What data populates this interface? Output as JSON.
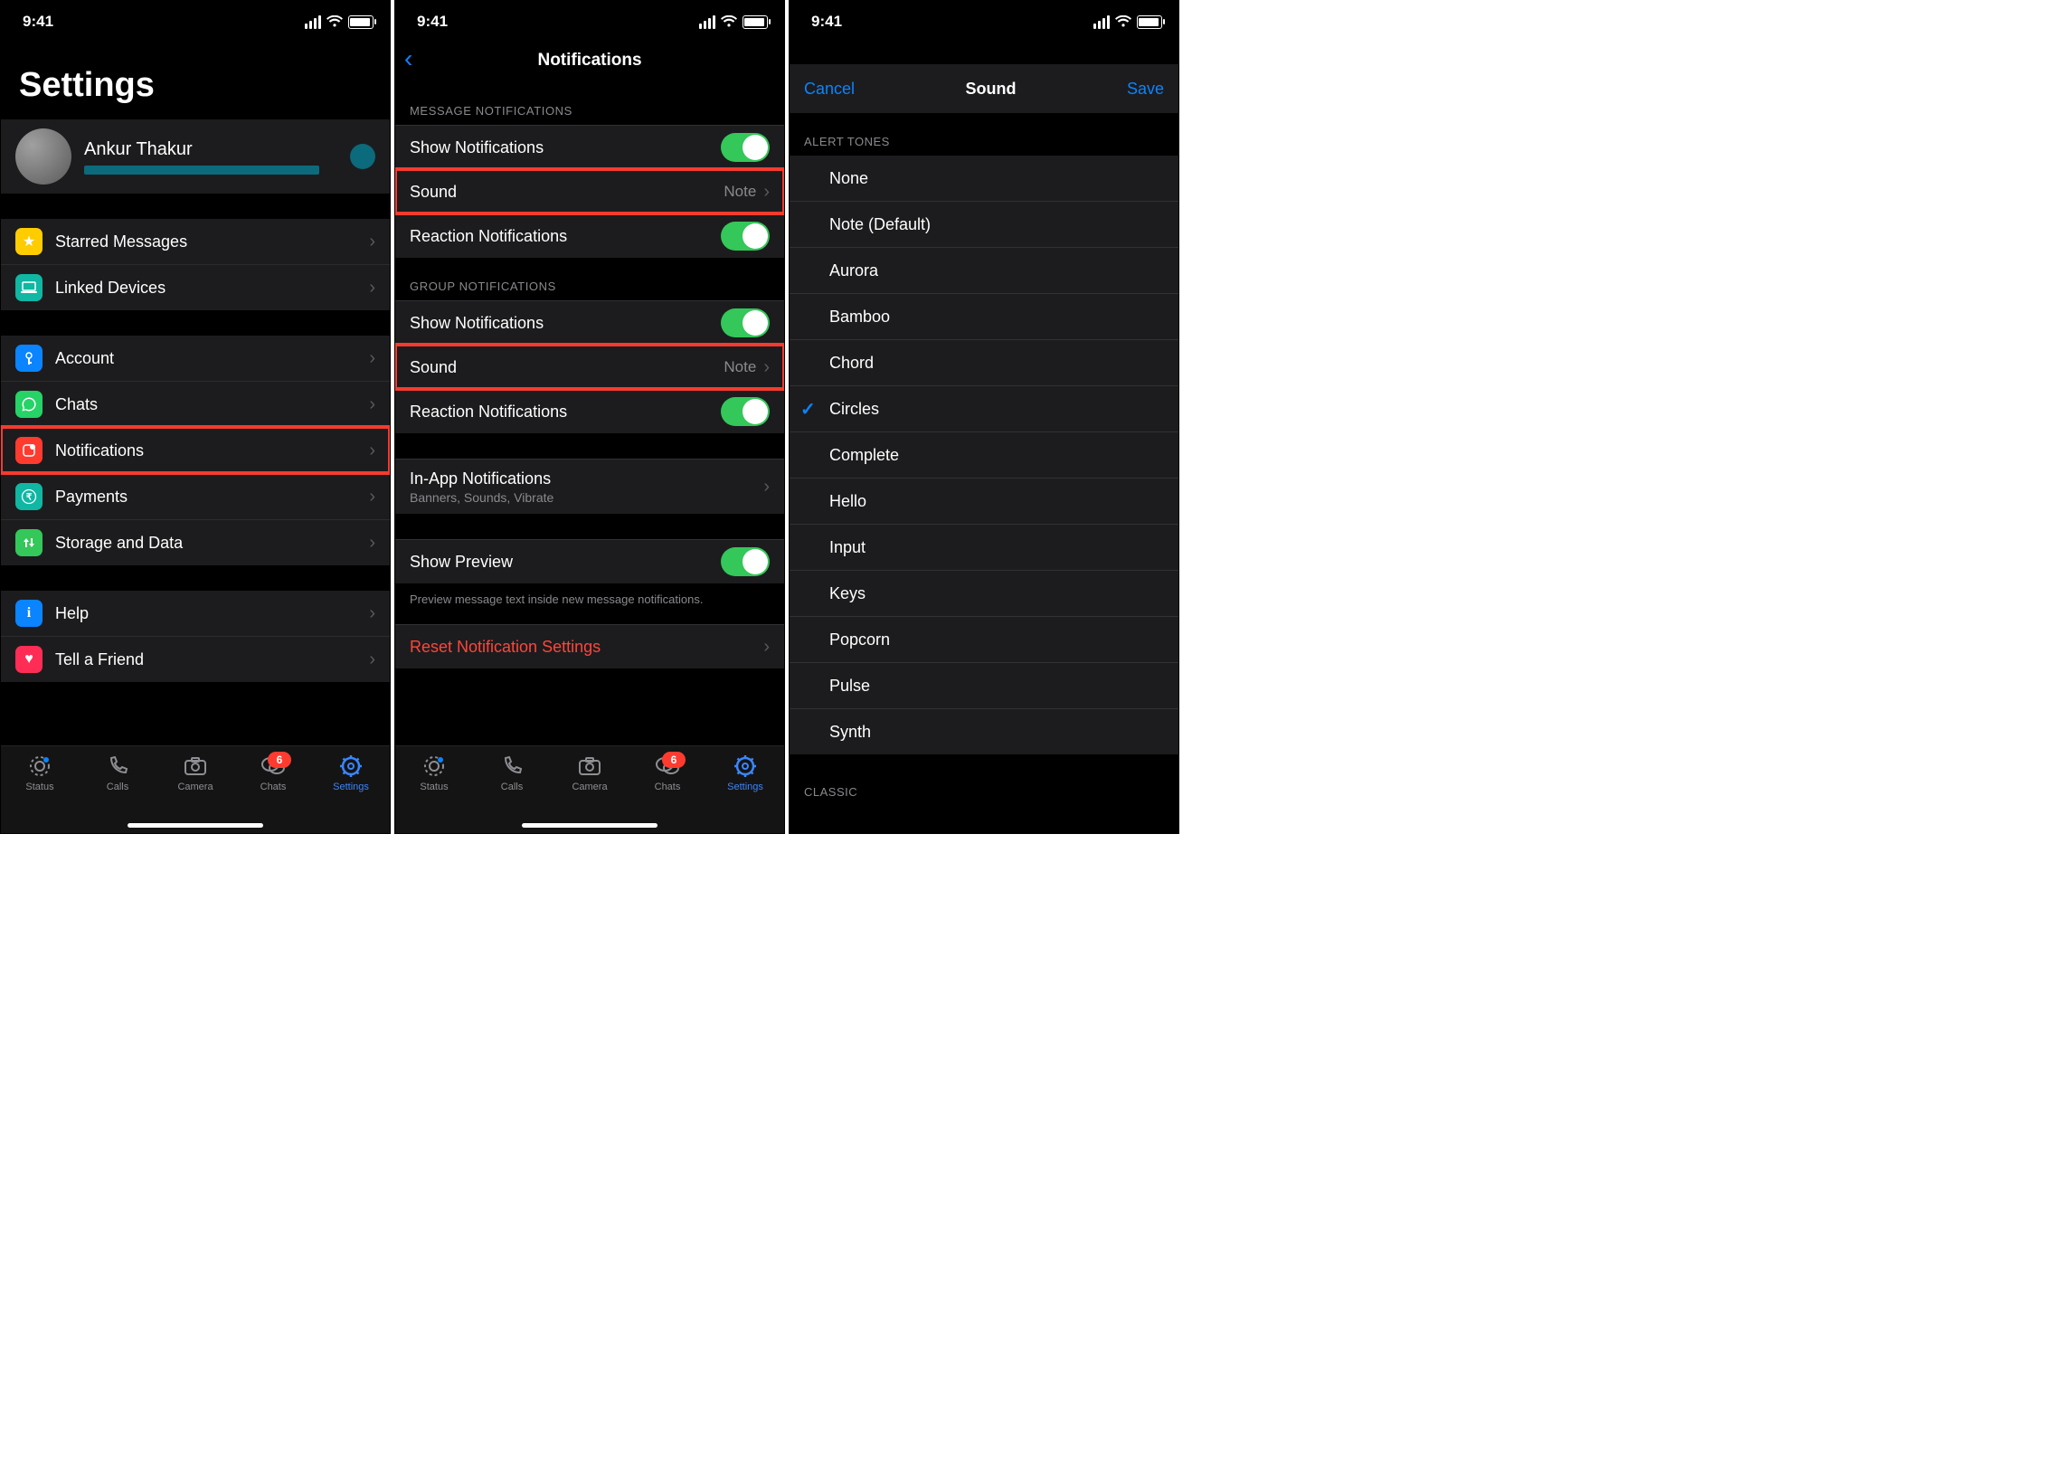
{
  "status": {
    "time": "9:41"
  },
  "panel1": {
    "title": "Settings",
    "profile": {
      "name": "Ankur Thakur"
    },
    "group1": [
      {
        "icon": "star-icon",
        "bg": "#ffcc00",
        "label": "Starred Messages"
      },
      {
        "icon": "laptop-icon",
        "bg": "#10b7a3",
        "label": "Linked Devices"
      }
    ],
    "group2": [
      {
        "icon": "key-icon",
        "bg": "#0a84ff",
        "label": "Account"
      },
      {
        "icon": "whatsapp-icon",
        "bg": "#25d366",
        "label": "Chats"
      },
      {
        "icon": "notification-icon",
        "bg": "#ff3b30",
        "label": "Notifications",
        "highlight": true
      },
      {
        "icon": "rupee-icon",
        "bg": "#10b7a3",
        "label": "Payments"
      },
      {
        "icon": "updown-icon",
        "bg": "#34c759",
        "label": "Storage and Data"
      }
    ],
    "group3": [
      {
        "icon": "info-icon",
        "bg": "#0a84ff",
        "label": "Help"
      },
      {
        "icon": "heart-icon",
        "bg": "#ff2d55",
        "label": "Tell a Friend"
      }
    ]
  },
  "panel2": {
    "title": "Notifications",
    "sections": {
      "msg_header": "MESSAGE NOTIFICATIONS",
      "grp_header": "GROUP NOTIFICATIONS"
    },
    "rows": {
      "show_notifs": "Show Notifications",
      "sound": "Sound",
      "sound_value": "Note",
      "reaction": "Reaction Notifications",
      "inapp": "In-App Notifications",
      "inapp_sub": "Banners, Sounds, Vibrate",
      "preview": "Show Preview",
      "preview_note": "Preview message text inside new message notifications.",
      "reset": "Reset Notification Settings"
    }
  },
  "panel3": {
    "cancel": "Cancel",
    "title": "Sound",
    "save": "Save",
    "header1": "ALERT TONES",
    "header2": "CLASSIC",
    "tones": [
      "None",
      "Note (Default)",
      "Aurora",
      "Bamboo",
      "Chord",
      "Circles",
      "Complete",
      "Hello",
      "Input",
      "Keys",
      "Popcorn",
      "Pulse",
      "Synth"
    ],
    "selected": "Circles"
  },
  "tabs": {
    "items": [
      "Status",
      "Calls",
      "Camera",
      "Chats",
      "Settings"
    ],
    "active": 4,
    "badge": "6"
  }
}
